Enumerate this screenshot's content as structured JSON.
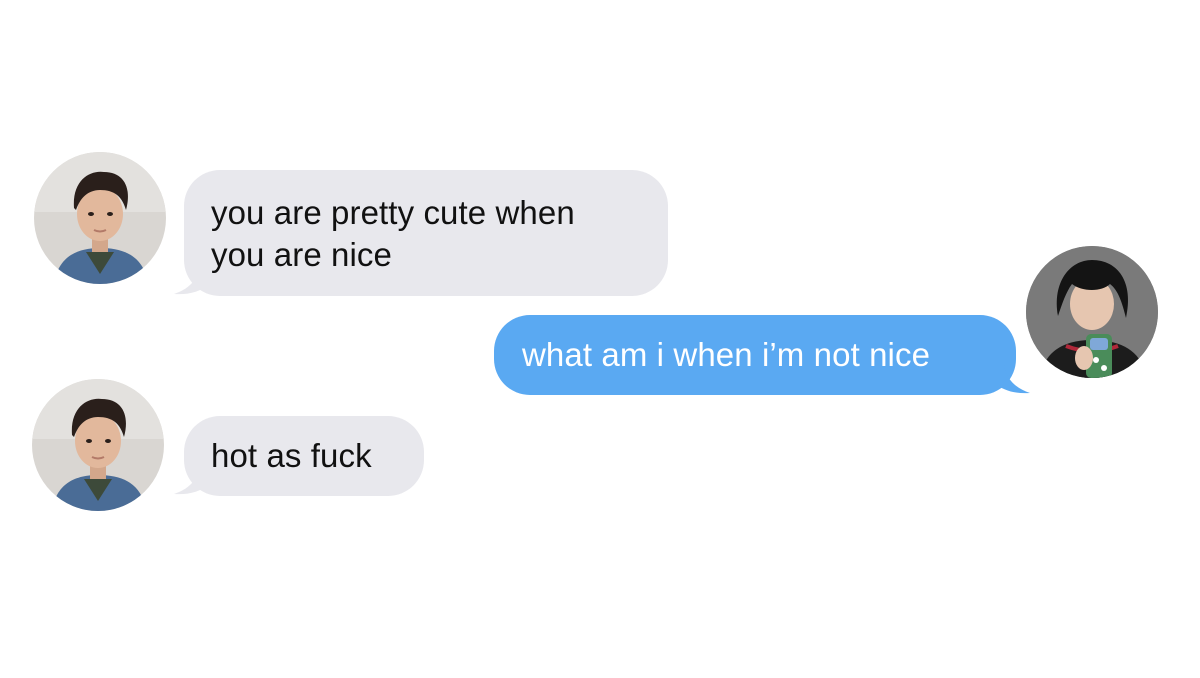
{
  "conversation": {
    "messages": [
      {
        "sender": "contact",
        "text": "you are pretty cute when\nyou are nice",
        "avatar": "contact-avatar"
      },
      {
        "sender": "me",
        "text": "what am i when i’m not nice",
        "avatar": "self-avatar"
      },
      {
        "sender": "contact",
        "text": "hot as fuck",
        "avatar": "contact-avatar"
      }
    ]
  },
  "colors": {
    "incoming_bubble": "#e8e8ed",
    "incoming_text": "#111111",
    "outgoing_bubble": "#5aa9f2",
    "outgoing_text": "#ffffff",
    "background": "#ffffff"
  }
}
